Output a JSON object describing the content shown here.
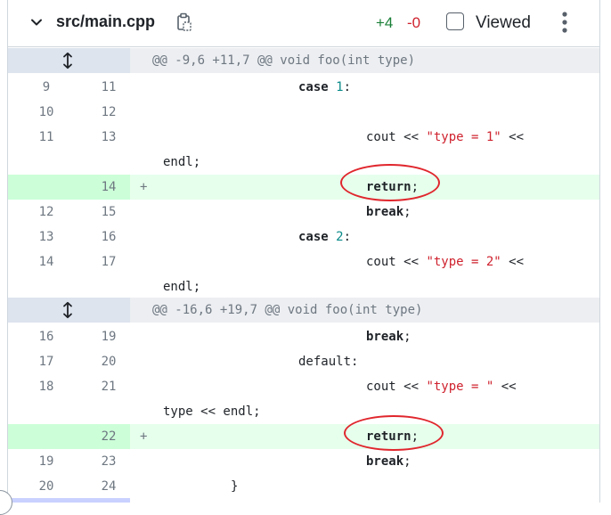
{
  "file": {
    "name": "src/main.cpp",
    "additions": "+4",
    "deletions": "-0",
    "viewed_label": "Viewed"
  },
  "icons": {
    "collapse": "chevron-down-icon",
    "copy": "copy-path-icon",
    "more": "kebab-menu-icon",
    "expand": "unfold-icon"
  },
  "hunks": [
    {
      "header": "@@ -9,6 +11,7 @@ void foo(int type)"
    },
    {
      "header": "@@ -16,6 +19,7 @@ void foo(int type)"
    }
  ],
  "lines": [
    {
      "old": "9",
      "new": "11",
      "sign": ""
    },
    {
      "old": "10",
      "new": "12",
      "sign": ""
    },
    {
      "old": "11",
      "new": "13",
      "sign": ""
    },
    {
      "old": "",
      "new": "14",
      "sign": "+"
    },
    {
      "old": "12",
      "new": "15",
      "sign": ""
    },
    {
      "old": "13",
      "new": "16",
      "sign": ""
    },
    {
      "old": "14",
      "new": "17",
      "sign": ""
    },
    {
      "old": "16",
      "new": "19",
      "sign": ""
    },
    {
      "old": "17",
      "new": "20",
      "sign": ""
    },
    {
      "old": "18",
      "new": "21",
      "sign": ""
    },
    {
      "old": "",
      "new": "22",
      "sign": "+"
    },
    {
      "old": "19",
      "new": "23",
      "sign": ""
    },
    {
      "old": "20",
      "new": "24",
      "sign": ""
    }
  ],
  "code": {
    "l1_kw": "case",
    "l1_num": "1",
    "l1_rest": ":",
    "l3_a": "cout << ",
    "l3_str": "\"type = 1\"",
    "l3_b": " <<",
    "wrap1": "endl;",
    "l4_kw": "return",
    "l4_rest": ";",
    "l5_kw": "break",
    "l5_rest": ";",
    "l6_kw": "case",
    "l6_num": "2",
    "l6_rest": ":",
    "l7_a": "cout << ",
    "l7_str": "\"type = 2\"",
    "l7_b": " <<",
    "wrap2": "endl;",
    "l8_kw": "break",
    "l8_rest": ";",
    "l9": "default:",
    "l10_a": "cout << ",
    "l10_str": "\"type = \"",
    "l10_b": " <<",
    "wrap3": "type << endl;",
    "l11_kw": "return",
    "l11_rest": ";",
    "l12_kw": "break",
    "l12_rest": ";",
    "l13": "}"
  },
  "colors": {
    "addition": "#1a7f37",
    "deletion": "#cf222e",
    "added_row": "#e6ffec",
    "annotation": "#e0262d"
  }
}
